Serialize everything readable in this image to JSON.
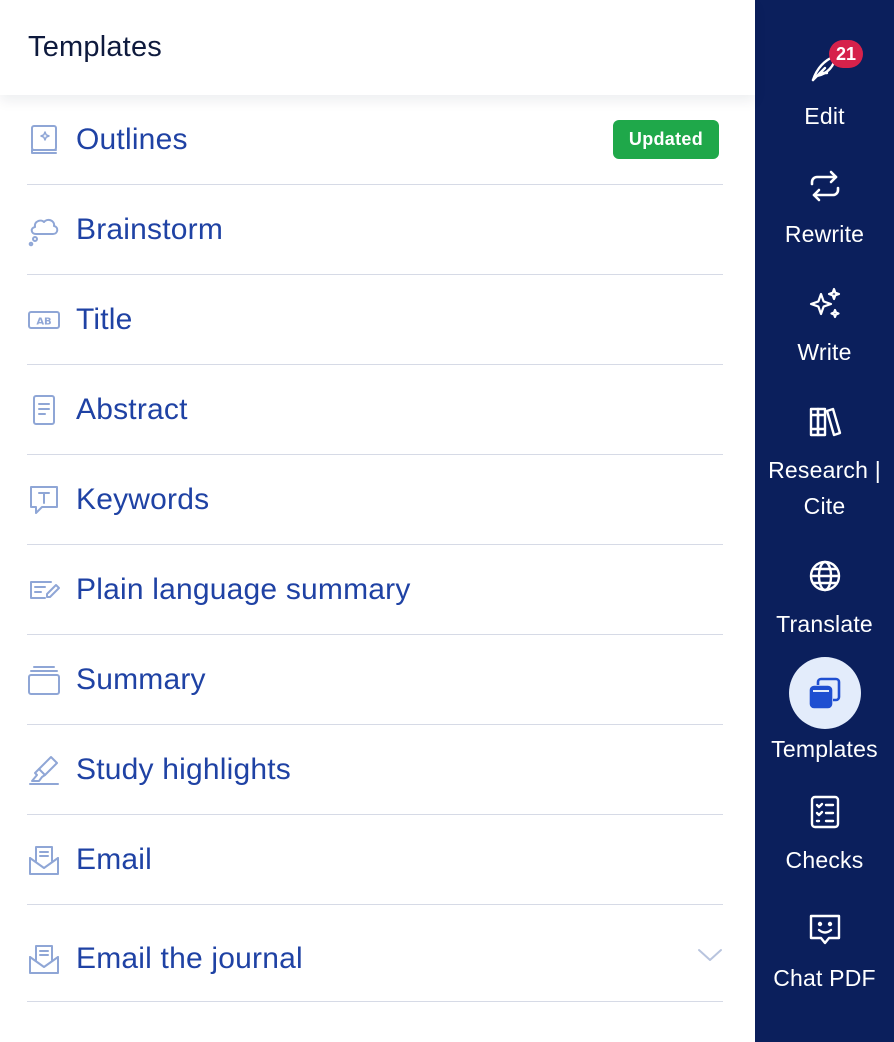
{
  "panel": {
    "title": "Templates",
    "items": [
      {
        "label": "Outlines",
        "icon": "book-sparkle-icon",
        "badge": "Updated"
      },
      {
        "label": "Brainstorm",
        "icon": "thought-cloud-icon"
      },
      {
        "label": "Title",
        "icon": "ab-title-icon"
      },
      {
        "label": "Abstract",
        "icon": "document-lines-icon"
      },
      {
        "label": "Keywords",
        "icon": "speech-t-icon"
      },
      {
        "label": "Plain language summary",
        "icon": "text-edit-icon"
      },
      {
        "label": "Summary",
        "icon": "stack-card-icon"
      },
      {
        "label": "Study highlights",
        "icon": "highlighter-icon"
      },
      {
        "label": "Email",
        "icon": "envelope-doc-icon"
      },
      {
        "label": "Email the journal",
        "icon": "envelope-doc-icon"
      }
    ]
  },
  "rail": {
    "items": [
      {
        "label": "Edit",
        "icon": "quill-icon",
        "count": "21"
      },
      {
        "label": "Rewrite",
        "icon": "repeat-icon"
      },
      {
        "label": "Write",
        "icon": "sparkles-icon"
      },
      {
        "label": "Research |",
        "label2": "Cite",
        "icon": "books-icon"
      },
      {
        "label": "Translate",
        "icon": "globe-icon"
      },
      {
        "label": "Templates",
        "icon": "windows-icon",
        "active": true
      },
      {
        "label": "Checks",
        "icon": "checklist-icon"
      },
      {
        "label": "Chat PDF",
        "icon": "chat-smile-icon"
      }
    ]
  },
  "colors": {
    "rail_bg": "#0b1f5c",
    "item_text": "#1f42a4",
    "badge_green": "#1fa84a",
    "count_red": "#d6224b",
    "active_circle": "#e3ecfb"
  }
}
